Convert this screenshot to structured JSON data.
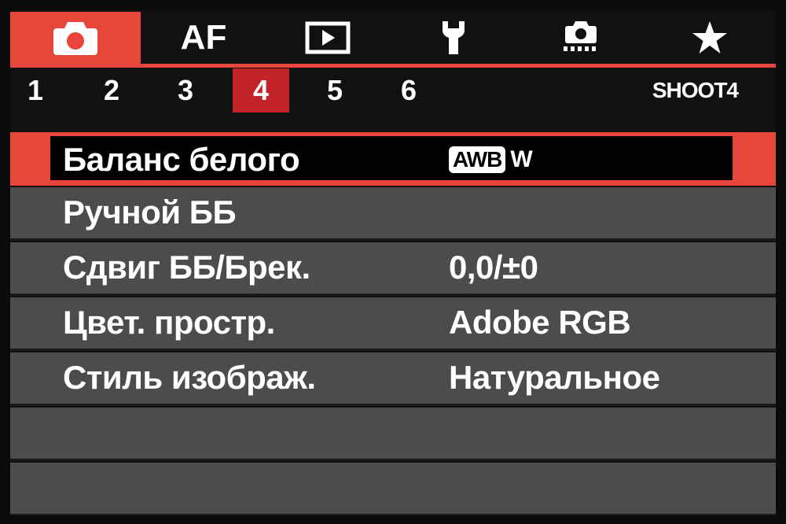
{
  "tabs": [
    {
      "icon": "camera-icon",
      "active": true
    },
    {
      "label": "AF",
      "active": false
    },
    {
      "icon": "playback-icon",
      "active": false
    },
    {
      "icon": "wrench-icon",
      "active": false
    },
    {
      "icon": "custom-camera-icon",
      "active": false
    },
    {
      "icon": "star-icon",
      "active": false
    }
  ],
  "subtabs": [
    "1",
    "2",
    "3",
    "4",
    "5",
    "6"
  ],
  "active_subtab": "4",
  "page_label": "SHOOT4",
  "menu": [
    {
      "label": "Баланс белого",
      "value_badge": "AWB",
      "value_suffix": "W",
      "selected": true
    },
    {
      "label": "Ручной ББ",
      "value": ""
    },
    {
      "label": "Сдвиг ББ/Брек.",
      "value": "0,0/±0"
    },
    {
      "label": "Цвет. простр.",
      "value": "Adobe RGB"
    },
    {
      "label": "Стиль изображ.",
      "value": "Натуральное"
    },
    {
      "label": "",
      "value": ""
    },
    {
      "label": "",
      "value": ""
    }
  ],
  "colors": {
    "accent": "#e8453b",
    "active_subtab": "#c4232a",
    "row_bg": "#4c4c4c"
  }
}
